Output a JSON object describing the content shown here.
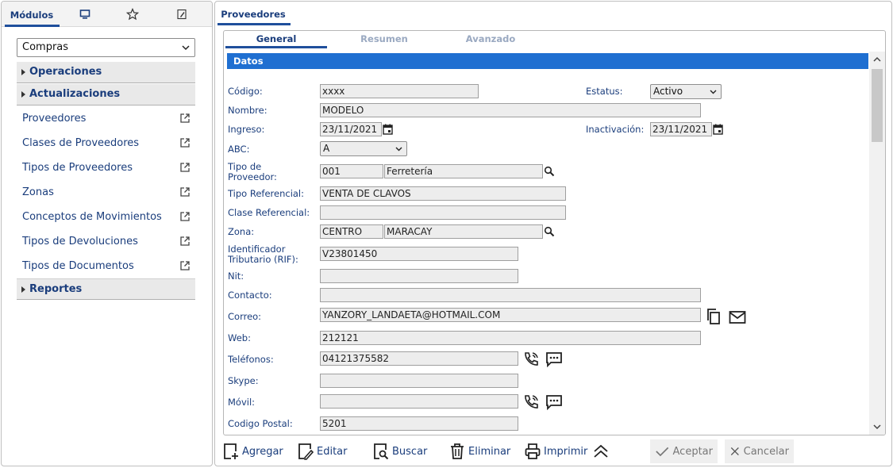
{
  "left_tabs": {
    "modulos_label": "Módulos"
  },
  "module_select": {
    "value": "Compras"
  },
  "groups": {
    "operaciones": "Operaciones",
    "actualizaciones": "Actualizaciones",
    "reportes": "Reportes"
  },
  "menu_items": [
    {
      "label": "Proveedores"
    },
    {
      "label": "Clases de Proveedores"
    },
    {
      "label": "Tipos de Proveedores"
    },
    {
      "label": "Zonas"
    },
    {
      "label": "Conceptos de Movimientos"
    },
    {
      "label": "Tipos de Devoluciones"
    },
    {
      "label": "Tipos de Documentos"
    }
  ],
  "main_tab": {
    "label": "Proveedores"
  },
  "sub_tabs": {
    "general": "General",
    "resumen": "Resumen",
    "avanzado": "Avanzado"
  },
  "section": {
    "title": "Datos"
  },
  "form": {
    "codigo": {
      "label": "Código:",
      "value": "xxxx"
    },
    "estatus": {
      "label": "Estatus:",
      "value": "Activo"
    },
    "nombre": {
      "label": "Nombre:",
      "value": "MODELO"
    },
    "ingreso": {
      "label": "Ingreso:",
      "value": "23/11/2021"
    },
    "inactivacion": {
      "label": "Inactivación:",
      "value": "23/11/2021"
    },
    "abc": {
      "label": "ABC:",
      "value": "A"
    },
    "tipo_proveedor": {
      "label_1": "Tipo de",
      "label_2": "Proveedor:",
      "code": "001",
      "value": "Ferretería"
    },
    "tipo_referencial": {
      "label": "Tipo Referencial:",
      "value": "VENTA DE CLAVOS"
    },
    "clase_referencial": {
      "label": "Clase Referencial:",
      "value": ""
    },
    "zona": {
      "label": "Zona:",
      "code": "CENTRO",
      "value": "MARACAY"
    },
    "rif": {
      "label_1": "Identificador",
      "label_2": "Tributario (RIF):",
      "value": "V23801450"
    },
    "nit": {
      "label": "Nit:",
      "value": ""
    },
    "contacto": {
      "label": "Contacto:",
      "value": ""
    },
    "correo": {
      "label": "Correo:",
      "value": "YANZORY_LANDAETA@HOTMAIL.COM"
    },
    "web": {
      "label": "Web:",
      "value": "212121"
    },
    "telefonos": {
      "label": "Teléfonos:",
      "value": "04121375582"
    },
    "skype": {
      "label": "Skype:",
      "value": ""
    },
    "movil": {
      "label": "Móvil:",
      "value": ""
    },
    "codigo_postal": {
      "label": "Codigo Postal:",
      "value": "5201"
    }
  },
  "actions": {
    "agregar": "Agregar",
    "editar": "Editar",
    "buscar": "Buscar",
    "eliminar": "Eliminar",
    "imprimir": "Imprimir",
    "aceptar": "Aceptar",
    "cancelar": "Cancelar"
  },
  "colors": {
    "accent": "#1f6fd1",
    "label_text": "#1a3d7c",
    "field_bg": "#ededed"
  }
}
